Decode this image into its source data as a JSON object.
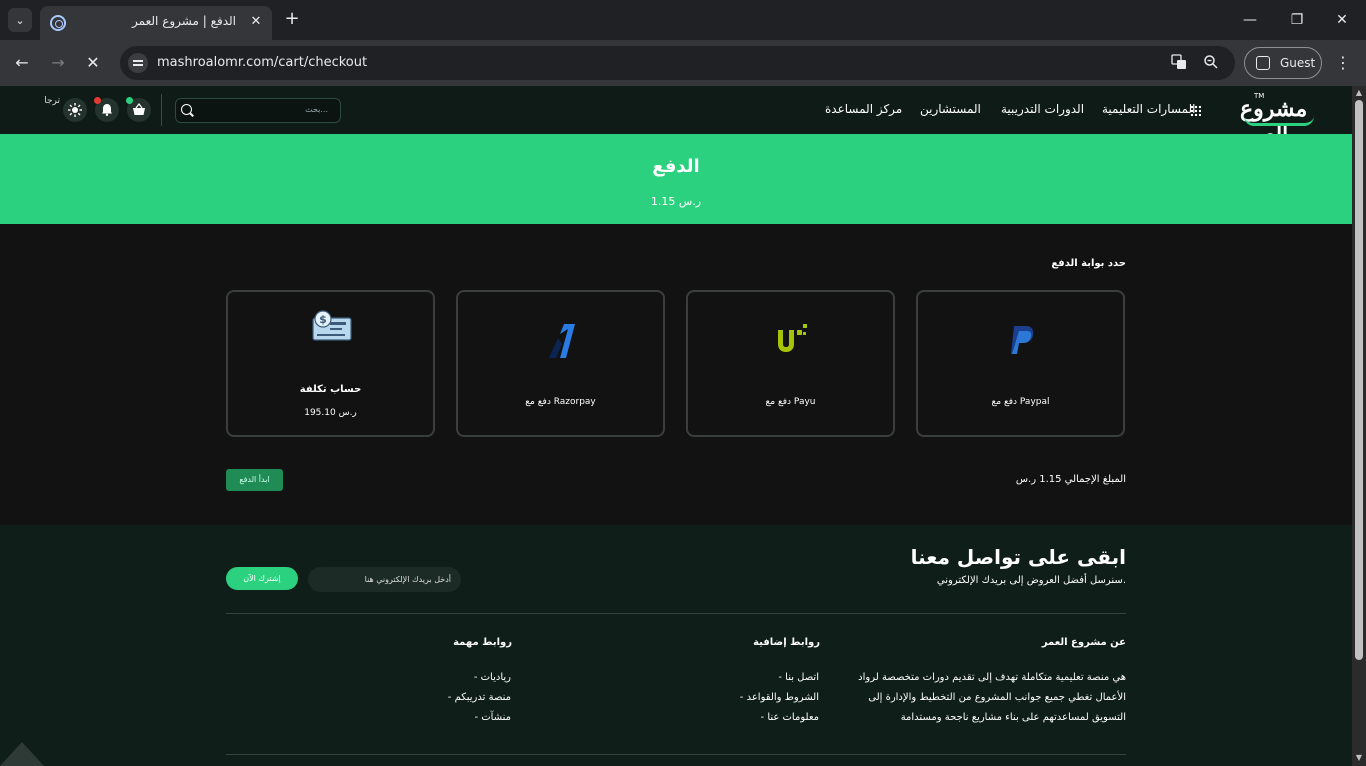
{
  "browser": {
    "tab_title": "الدفع | مشروع العمر",
    "tab_close": "✕",
    "new_tab": "+",
    "url": "mashroalomr.com/cart/checkout",
    "profile_label": "Guest",
    "window_controls": {
      "minimize": "—",
      "restore": "❐",
      "close": "✕"
    },
    "nav": {
      "back": "←",
      "forward": "→",
      "stop": "✕",
      "menu": "⋮",
      "tab_list": "⌄"
    }
  },
  "header": {
    "logo_text": "مشروع العمر",
    "logo_tm": "TM",
    "nav": {
      "learning_paths": "المسارات التعليمية",
      "courses": "الدورات التدريبية",
      "consultants": "المستشارين",
      "help_center": "مركز المساعدة"
    },
    "search_placeholder": "بحث...",
    "avatar_alt": "ترجا"
  },
  "banner": {
    "title": "الدفع",
    "amount": "1.15 ر.س"
  },
  "checkout": {
    "section_title": "حدد بوابة الدفع",
    "gateways": [
      {
        "label": "دفع مع Paypal"
      },
      {
        "label": "دفع مع Payu"
      },
      {
        "label": "دفع مع Razorpay"
      },
      {
        "title": "حساب تكلفة",
        "price": "195.10 ر.س"
      }
    ],
    "total_label": "المبلغ الإجمالي 1.15 ر.س",
    "pay_button": "ابدأ الدفع"
  },
  "footer": {
    "title": "ابقى على تواصل معنا",
    "subtitle": "سنرسل أفضل العروض إلى بريدك الإلكتروني.",
    "email_placeholder": "أدخل بريدك الإلكتروني هنا",
    "subscribe_button": "إشترك الآن",
    "about": {
      "title": "عن مشروع العمر",
      "lines": [
        "هي منصة تعليمية متكاملة تهدف إلى تقديم دورات متخصصة لرواد",
        "الأعمال تغطي جميع جوانب المشروع من التخطيط والإدارة إلى",
        "التسويق لمساعدتهم على بناء مشاريع ناجحة ومستدامة"
      ]
    },
    "extra_links": {
      "title": "روابط إضافية",
      "items": [
        "- اتصل بنا",
        "- الشروط والقواعد",
        "- معلومات عنا"
      ]
    },
    "important_links": {
      "title": "روابط مهمة",
      "items": [
        "- رياديات",
        "- منصة تدريبكم",
        "- منشآت"
      ]
    }
  },
  "colors": {
    "accent": "#2bd17e",
    "header_bg": "#0e1b16",
    "footer_bg": "#0f1e19",
    "page_bg": "#121212"
  }
}
